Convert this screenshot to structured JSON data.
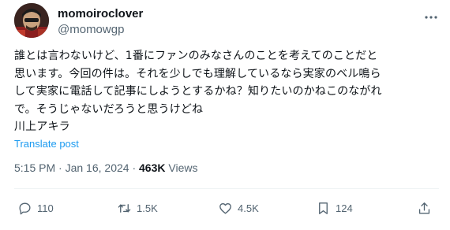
{
  "user": {
    "display_name": "momoiroclover",
    "handle": "@momowgp",
    "avatar_icon": "user-avatar"
  },
  "tweet": {
    "text_lines": [
      "誰とは言わないけど、1番にファンのみなさんのことを考えてのことだと",
      "思います。今回の件は。それを少しでも理解しているなら実家のベル鳴ら",
      "して実家に電話して記事にしようとするかね？知りたいのかねこのながれ",
      "で。そうじゃないだろうと思うけどね",
      "川上アキラ"
    ],
    "translate_label": "Translate post",
    "time": "5:15 PM",
    "separator": "·",
    "date": "Jan 16, 2024",
    "views_count": "463K",
    "views_label": "Views"
  },
  "actions": {
    "replies": "110",
    "reposts": "1.5K",
    "likes": "4.5K",
    "bookmarks": "124"
  },
  "colors": {
    "text": "#0f1419",
    "secondary": "#536471",
    "link": "#1d9bf0",
    "divider": "#eff3f4"
  }
}
